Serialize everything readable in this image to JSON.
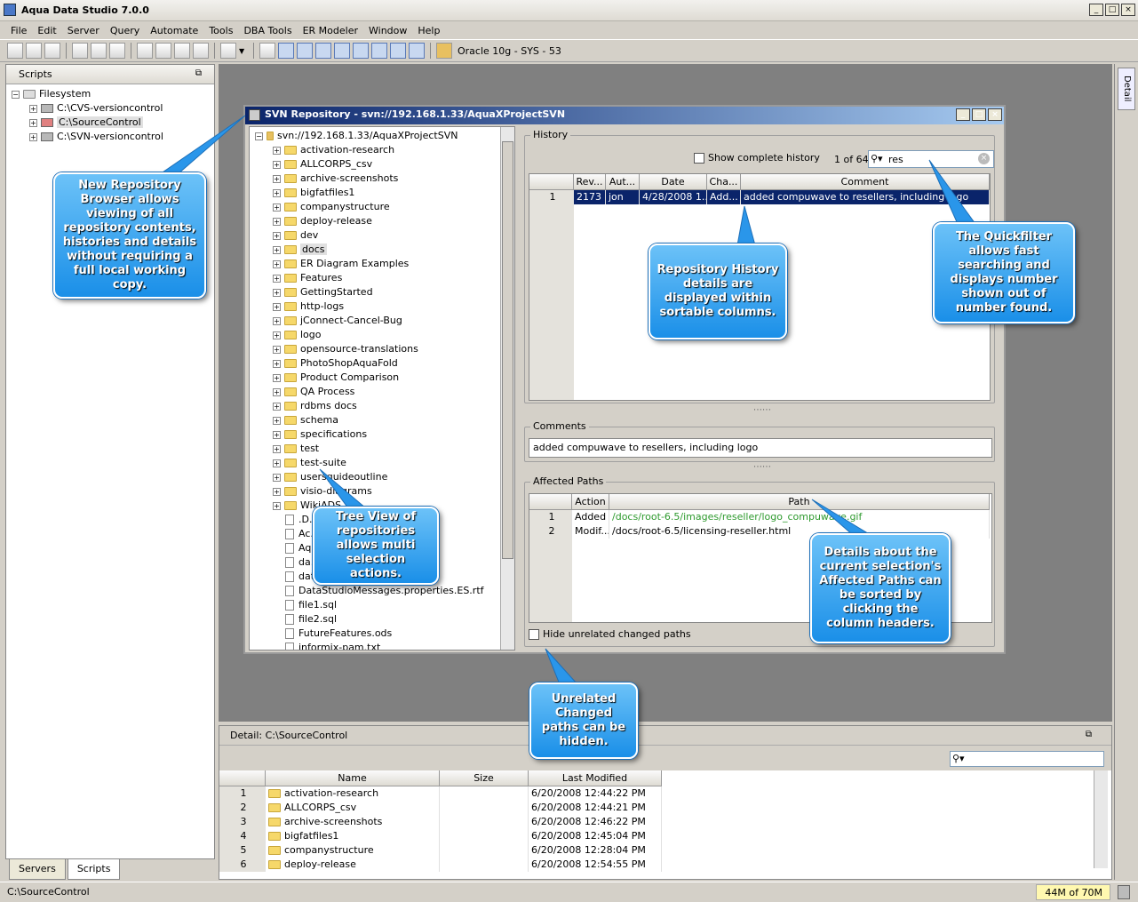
{
  "app": {
    "title": "Aqua Data Studio 7.0.0"
  },
  "menu": [
    "File",
    "Edit",
    "Server",
    "Query",
    "Automate",
    "Tools",
    "DBA Tools",
    "ER Modeler",
    "Window",
    "Help"
  ],
  "toolbar": {
    "connection": "Oracle 10g - SYS - 53"
  },
  "scripts_panel": {
    "title": "Scripts",
    "root": "Filesystem",
    "items": [
      "C:\\CVS-versioncontrol",
      "C:\\SourceControl",
      "C:\\SVN-versioncontrol"
    ],
    "tabs": [
      "Servers",
      "Scripts"
    ]
  },
  "right_strip": {
    "label": "Detail"
  },
  "svn": {
    "title": "SVN Repository - svn://192.168.1.33/AquaXProjectSVN",
    "root": "svn://192.168.1.33/AquaXProjectSVN",
    "folders": [
      "activation-research",
      "ALLCORPS_csv",
      "archive-screenshots",
      "bigfatfiles1",
      "companystructure",
      "deploy-release",
      "dev",
      "docs",
      "ER Diagram Examples",
      "Features",
      "GettingStarted",
      "http-logs",
      "jConnect-Cancel-Bug",
      "logo",
      "opensource-translations",
      "PhotoShopAquaFold",
      "Product Comparison",
      "QA Process",
      "rdbms docs",
      "schema",
      "specifications",
      "test",
      "test-suite",
      "usersguideoutline",
      "visio-diagrams",
      "WikiADS"
    ],
    "files": [
      ".D...S...",
      "Ac...",
      "Aqua...Keys.txt",
      "da...",
      "dat...studio-bundled_jre.bat",
      "DataStudioMessages.properties.ES.rtf",
      "file1.sql",
      "file2.sql",
      "FutureFeatures.ods",
      "informix-pam.txt"
    ],
    "history": {
      "label": "History",
      "show_complete": "Show complete history",
      "count": "1 of 64",
      "search": "res",
      "columns": [
        "Rev...",
        "Aut...",
        "Date",
        "Cha...",
        "Comment"
      ],
      "rows": [
        {
          "n": "1",
          "rev": "2173",
          "author": "jon",
          "date": "4/28/2008 1...",
          "changes": "Add...",
          "comment": "added compuwave to resellers, including logo"
        }
      ]
    },
    "comments": {
      "label": "Comments",
      "text": "added compuwave to resellers, including logo"
    },
    "affected": {
      "label": "Affected Paths",
      "columns": [
        "Action",
        "Path"
      ],
      "rows": [
        {
          "n": "1",
          "action": "Added",
          "path": "/docs/root-6.5/images/reseller/logo_compuwave.gif"
        },
        {
          "n": "2",
          "action": "Modif...",
          "path": "/docs/root-6.5/licensing-reseller.html"
        }
      ],
      "hide_unrelated": "Hide unrelated changed paths"
    }
  },
  "detail": {
    "title": "Detail: C:\\SourceControl",
    "columns": [
      "Name",
      "Size",
      "Last Modified"
    ],
    "rows": [
      {
        "n": "1",
        "name": "activation-research",
        "size": "",
        "modified": "6/20/2008 12:44:22 PM"
      },
      {
        "n": "2",
        "name": "ALLCORPS_csv",
        "size": "",
        "modified": "6/20/2008 12:44:21 PM"
      },
      {
        "n": "3",
        "name": "archive-screenshots",
        "size": "",
        "modified": "6/20/2008 12:46:22 PM"
      },
      {
        "n": "4",
        "name": "bigfatfiles1",
        "size": "",
        "modified": "6/20/2008 12:45:04 PM"
      },
      {
        "n": "5",
        "name": "companystructure",
        "size": "",
        "modified": "6/20/2008 12:28:04 PM"
      },
      {
        "n": "6",
        "name": "deploy-release",
        "size": "",
        "modified": "6/20/2008 12:54:55 PM"
      }
    ]
  },
  "callouts": {
    "repo": "New Repository Browser allows viewing of all repository contents, histories and details without requiring a full local working copy.",
    "history": "Repository History details are displayed within sortable columns.",
    "quickfilter": "The Quickfilter allows fast searching and displays number shown out of number found.",
    "tree": "Tree View of repositories allows multi selection actions.",
    "paths": "Details about the current selection's Affected Paths can be sorted by clicking the column headers.",
    "unrelated": "Unrelated Changed paths can be hidden."
  },
  "status": {
    "path": "C:\\SourceControl",
    "memory": "44M of 70M"
  },
  "colors": {
    "selection": "#0a246a",
    "callout": "#1a8fe8",
    "added_path": "#2e9a2e"
  }
}
